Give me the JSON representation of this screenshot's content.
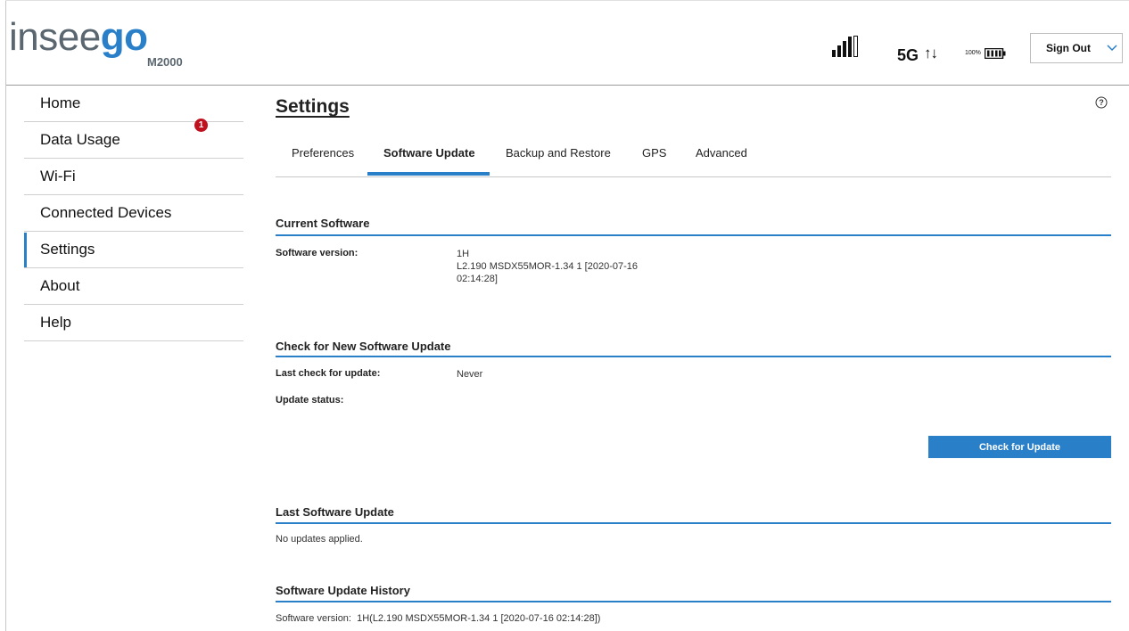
{
  "header": {
    "logo_light": "insee",
    "logo_bold": "go",
    "model": "M2000",
    "network": "5G",
    "arrows": "↑↓",
    "battery_pct": "100%",
    "sign_out_label": "Sign Out"
  },
  "sidebar": {
    "items": [
      {
        "label": "Home"
      },
      {
        "label": "Data Usage"
      },
      {
        "label": "Wi-Fi"
      },
      {
        "label": "Connected Devices"
      },
      {
        "label": "Settings"
      },
      {
        "label": "About"
      },
      {
        "label": "Help"
      }
    ],
    "connected_devices_badge": "1",
    "active_item": "Settings"
  },
  "main": {
    "title": "Settings",
    "tabs": [
      {
        "label": "Preferences"
      },
      {
        "label": "Software Update"
      },
      {
        "label": "Backup and Restore"
      },
      {
        "label": "GPS"
      },
      {
        "label": "Advanced"
      }
    ],
    "active_tab": "Software Update",
    "current_software": {
      "heading": "Current Software",
      "version_label": "Software version:",
      "version_line1": "1H",
      "version_line2": "L2.190 MSDX55MOR-1.34 1 [2020-07-16 02:14:28]"
    },
    "check_update": {
      "heading": "Check for New Software Update",
      "last_check_label": "Last check for update:",
      "last_check_value": "Never",
      "status_label": "Update status:",
      "button_label": "Check for Update"
    },
    "last_update": {
      "heading": "Last Software Update",
      "text": "No updates applied."
    },
    "history": {
      "heading": "Software Update History",
      "text": "Software version:  1H(L2.190 MSDX55MOR-1.34 1 [2020-07-16 02:14:28])"
    }
  },
  "colors": {
    "accent": "#2a7fc9",
    "badge": "#c0111e",
    "logo_gray": "#5b6770"
  }
}
